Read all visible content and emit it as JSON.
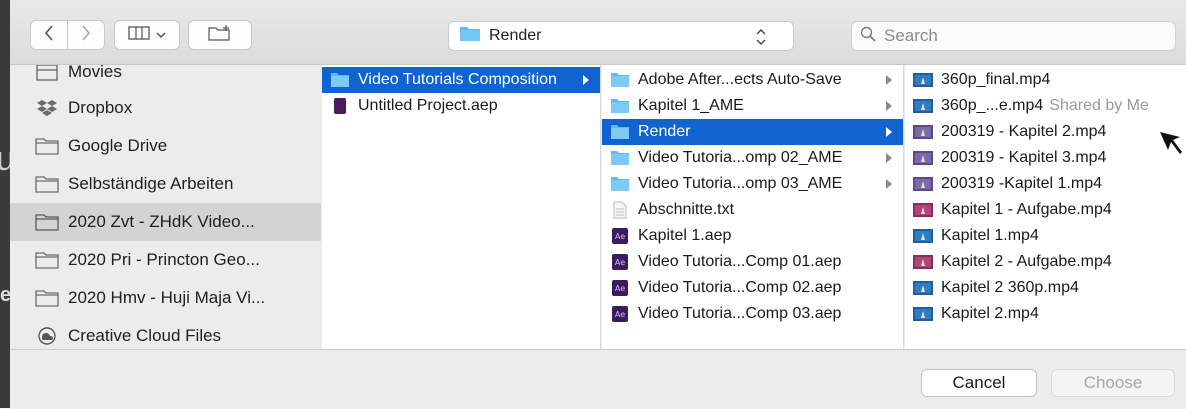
{
  "toolbar": {
    "location_label": "Render",
    "search_placeholder": "Search"
  },
  "sidebar": {
    "items": [
      {
        "label": "Movies",
        "icon": "movies-icon"
      },
      {
        "label": "Dropbox",
        "icon": "dropbox-icon"
      },
      {
        "label": "Google Drive",
        "icon": "folder-icon"
      },
      {
        "label": "Selbständige Arbeiten",
        "icon": "folder-icon"
      },
      {
        "label": "2020 Zvt - ZHdK Video...",
        "icon": "folder-icon",
        "selected": true
      },
      {
        "label": "2020 Pri -  Princton Geo...",
        "icon": "folder-icon"
      },
      {
        "label": "2020 Hmv - Huji Maja Vi...",
        "icon": "folder-icon"
      },
      {
        "label": "Creative Cloud Files",
        "icon": "creative-cloud-icon"
      }
    ]
  },
  "columns": {
    "col1": [
      {
        "label": "Video Tutorials Composition",
        "icon": "folder-icon",
        "selected": true,
        "has_children": true
      },
      {
        "label": "Untitled Project.aep",
        "icon": "premiere-project-icon"
      }
    ],
    "col2": [
      {
        "label": "Adobe After...ects Auto-Save",
        "icon": "folder-icon",
        "has_children": true
      },
      {
        "label": "Kapitel 1_AME",
        "icon": "folder-icon",
        "has_children": true
      },
      {
        "label": "Render",
        "icon": "folder-icon",
        "selected": true,
        "has_children": true
      },
      {
        "label": "Video Tutoria...omp 02_AME",
        "icon": "folder-icon",
        "has_children": true
      },
      {
        "label": "Video Tutoria...omp 03_AME",
        "icon": "folder-icon",
        "has_children": true
      },
      {
        "label": "Abschnitte.txt",
        "icon": "text-file-icon"
      },
      {
        "label": "Kapitel 1.aep",
        "icon": "after-effects-icon"
      },
      {
        "label": "Video Tutoria...Comp 01.aep",
        "icon": "after-effects-icon"
      },
      {
        "label": "Video Tutoria...Comp 02.aep",
        "icon": "after-effects-icon"
      },
      {
        "label": "Video Tutoria...Comp 03.aep",
        "icon": "after-effects-icon"
      }
    ],
    "col3": [
      {
        "label": "360p_final.mp4",
        "icon": "video-thumbnail-icon",
        "variant": "blue"
      },
      {
        "label": "360p_...e.mp4",
        "shared": "Shared by Me",
        "icon": "video-thumbnail-icon",
        "variant": "blue"
      },
      {
        "label": "200319 - Kapitel 2.mp4",
        "icon": "video-thumbnail-icon",
        "variant": "purple"
      },
      {
        "label": "200319 - Kapitel 3.mp4",
        "icon": "video-thumbnail-icon",
        "variant": "purple"
      },
      {
        "label": "200319 -Kapitel 1.mp4",
        "icon": "video-thumbnail-icon",
        "variant": "purple"
      },
      {
        "label": "Kapitel 1 - Aufgabe.mp4",
        "icon": "video-thumbnail-icon",
        "variant": "magenta"
      },
      {
        "label": "Kapitel 1.mp4",
        "icon": "video-thumbnail-icon",
        "variant": "blue"
      },
      {
        "label": "Kapitel 2 - Aufgabe.mp4",
        "icon": "video-thumbnail-icon",
        "variant": "magenta"
      },
      {
        "label": "Kapitel 2 360p.mp4",
        "icon": "video-thumbnail-icon",
        "variant": "blue"
      },
      {
        "label": "Kapitel 2.mp4",
        "icon": "video-thumbnail-icon",
        "variant": "blue"
      }
    ]
  },
  "footer": {
    "cancel_label": "Cancel",
    "choose_label": "Choose"
  },
  "colors": {
    "selection": "#1064d2",
    "folder": "#5fb8ee",
    "after_effects": "#3a1b5c",
    "premiere": "#4a1a5f"
  }
}
